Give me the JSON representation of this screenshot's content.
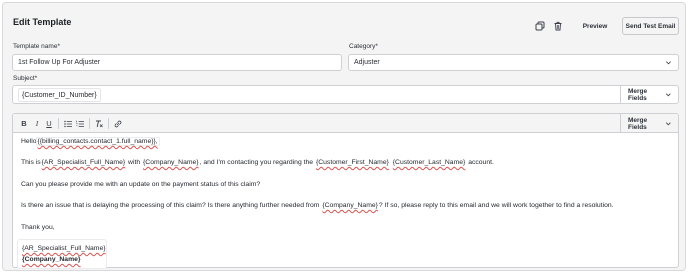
{
  "header": {
    "title": "Edit Template",
    "preview_label": "Preview",
    "send_test_label": "Send Test Email"
  },
  "form": {
    "template_name_label": "Template name*",
    "template_name_value": "1st Follow Up For Adjuster",
    "category_label": "Category*",
    "category_value": "Adjuster",
    "subject_label": "Subject*",
    "subject_value": "{Customer_ID_Number}",
    "merge_fields_label": "Merge Fields"
  },
  "toolbar": {
    "bold": "B",
    "italic": "I",
    "underline": "U",
    "merge_fields_label": "Merge Fields"
  },
  "body": {
    "greeting_prefix": "Hello ",
    "greeting_field": "{{billing_contacts.contact_1.full_name}},",
    "l1_a": "This is ",
    "l1_f1": "{AR_Specialist_Full_Name}",
    "l1_b": " with ",
    "l1_f2": "{Company_Name}",
    "l1_c": ", and I'm contacting you regarding the ",
    "l1_f3": "{Customer_First_Name}",
    "l1_d": " ",
    "l1_f4": "{Customer_Last_Name}",
    "l1_e": " account.",
    "l2": "Can you please provide me with an update on the payment status of this claim?",
    "l3_a": "Is there an issue that is delaying the processing of this claim? Is there anything further needed from ",
    "l3_f": "{Company_Name}",
    "l3_b": "? If so, please reply to this email and we will work together to find a resolution.",
    "thanks": "Thank you,",
    "sig_name": "{AR_Specialist_Full_Name}",
    "sig_company": "{Company_Name}"
  },
  "icons": [
    "copy-icon",
    "trash-icon",
    "chevron-down-icon",
    "bullet-list-icon",
    "numbered-list-icon",
    "clear-format-icon",
    "link-icon"
  ]
}
